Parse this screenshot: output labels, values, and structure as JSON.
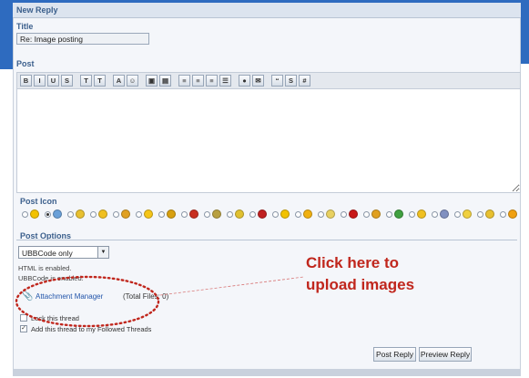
{
  "header": {
    "title": "New Reply"
  },
  "title_section": {
    "label": "Title",
    "value": "Re: Image posting"
  },
  "post_section": {
    "label": "Post"
  },
  "toolbar": {
    "buttons": [
      {
        "name": "bold-button",
        "glyph": "B"
      },
      {
        "name": "italic-button",
        "glyph": "I"
      },
      {
        "name": "underline-button",
        "glyph": "U"
      },
      {
        "name": "strike-button",
        "glyph": "S"
      },
      {
        "name": "text-button",
        "glyph": "T"
      },
      {
        "name": "text-size-button",
        "glyph": "T"
      },
      {
        "name": "color-button",
        "glyph": "A"
      },
      {
        "name": "smiley-button",
        "glyph": "☺"
      },
      {
        "name": "image-button",
        "glyph": "▣"
      },
      {
        "name": "media-button",
        "glyph": "▤"
      },
      {
        "name": "align-left-button",
        "glyph": "≡"
      },
      {
        "name": "align-center-button",
        "glyph": "≡"
      },
      {
        "name": "align-right-button",
        "glyph": "≡"
      },
      {
        "name": "list-button",
        "glyph": "☰"
      },
      {
        "name": "link-button",
        "glyph": "●"
      },
      {
        "name": "email-button",
        "glyph": "✉"
      },
      {
        "name": "quote-button",
        "glyph": "“"
      },
      {
        "name": "spoiler-button",
        "glyph": "S"
      },
      {
        "name": "code-button",
        "glyph": "#"
      }
    ]
  },
  "post_icon": {
    "label": "Post Icon",
    "icons": [
      "#f2c200",
      "#6aa0d8",
      "#e8c030",
      "#f0c020",
      "#e0a020",
      "#f5c518",
      "#d8a010",
      "#c83020",
      "#b8a040",
      "#e0c030",
      "#c02020",
      "#f2c200",
      "#f0b010",
      "#e8d060",
      "#c81818",
      "#e0a020",
      "#40a040",
      "#f0c020",
      "#8090c0",
      "#f0d040",
      "#e8c030",
      "#f0a010"
    ]
  },
  "post_options": {
    "label": "Post Options",
    "markup_select": "UBBCode only",
    "html_status": "HTML is enabled.",
    "ubbcode_status": "UBBCode is enabled.",
    "attachment_link": "Attachment Manager",
    "attachment_count": "(Total Files: 0)",
    "lock_thread": "Lock this thread",
    "follow_thread": "Add this thread to my Followed Threads"
  },
  "actions": {
    "post_reply": "Post Reply",
    "preview_reply": "Preview Reply"
  },
  "annotation": {
    "line1": "Click here to",
    "line2": "upload images",
    "color": "#c0261c"
  },
  "colors": {
    "header_blue": "#2e6bbf",
    "link_blue": "#2255aa",
    "label_blue": "#3b5f8c"
  }
}
